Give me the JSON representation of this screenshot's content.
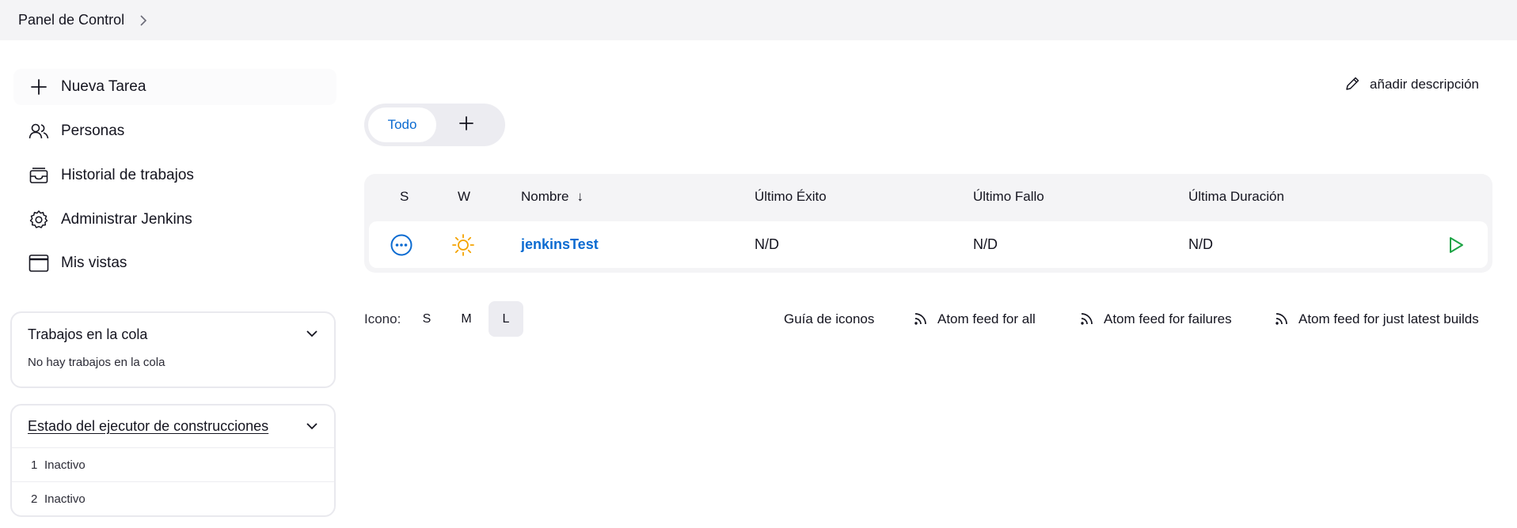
{
  "breadcrumb": {
    "root": "Panel de Control"
  },
  "sidebar": {
    "tasks": [
      {
        "label": "Nueva Tarea",
        "icon": "plus-icon"
      },
      {
        "label": "Personas",
        "icon": "people-icon"
      },
      {
        "label": "Historial de trabajos",
        "icon": "inbox-icon"
      },
      {
        "label": "Administrar Jenkins",
        "icon": "gear-icon"
      },
      {
        "label": "Mis vistas",
        "icon": "window-icon"
      }
    ],
    "queue": {
      "title": "Trabajos en la cola",
      "empty": "No hay trabajos en la cola"
    },
    "executors": {
      "title": "Estado del ejecutor de construcciones",
      "items": [
        {
          "num": "1",
          "status": "Inactivo"
        },
        {
          "num": "2",
          "status": "Inactivo"
        }
      ]
    }
  },
  "main": {
    "add_description": "añadir descripción",
    "tabs": {
      "all": "Todo"
    },
    "table": {
      "headers": {
        "s": "S",
        "w": "W",
        "name": "Nombre",
        "sort_arrow": "↓",
        "last_success": "Último Éxito",
        "last_failure": "Último Fallo",
        "last_duration": "Última Duración"
      },
      "rows": [
        {
          "name": "jenkinsTest",
          "last_success": "N/D",
          "last_failure": "N/D",
          "last_duration": "N/D",
          "status_icon": "not-built-icon",
          "weather_icon": "sunny-icon"
        }
      ]
    },
    "footer": {
      "icon_label": "Icono:",
      "sizes": [
        "S",
        "M",
        "L"
      ],
      "active_size": "L",
      "legend": "Guía de iconos",
      "feeds": [
        "Atom feed for all",
        "Atom feed for failures",
        "Atom feed for just latest builds"
      ]
    }
  },
  "colors": {
    "link": "#0b6bd1",
    "sun": "#f4a300",
    "run": "#1ea446"
  }
}
